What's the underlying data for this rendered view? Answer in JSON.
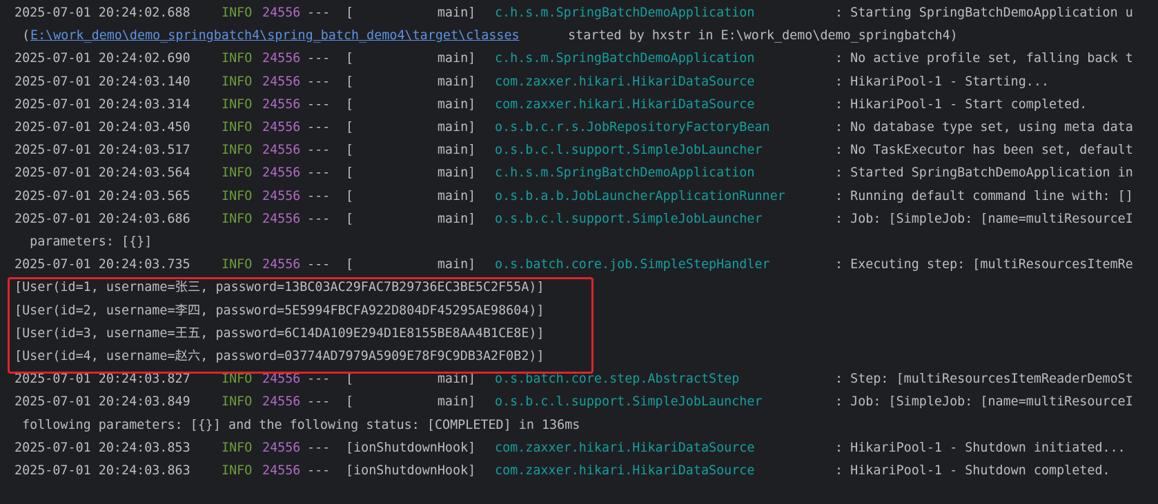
{
  "console": {
    "lines": [
      {
        "kind": "log",
        "ts": "2025-07-01 20:24:02.688",
        "level": "INFO",
        "pid": "24556",
        "sep": "---",
        "thread": "[           main]",
        "logger": "c.h.s.m.SpringBatchDemoApplication",
        "msg": ": Starting SpringBatchDemoApplication u"
      },
      {
        "kind": "cont",
        "pre": " (",
        "link": "E:\\work_demo\\demo_springbatch4\\spring_batch_demo4\\target\\classes",
        "text": " started by hxstr in E:\\work_demo\\demo_springbatch4)"
      },
      {
        "kind": "log",
        "ts": "2025-07-01 20:24:02.690",
        "level": "INFO",
        "pid": "24556",
        "sep": "---",
        "thread": "[           main]",
        "logger": "c.h.s.m.SpringBatchDemoApplication",
        "msg": ": No active profile set, falling back t"
      },
      {
        "kind": "log",
        "ts": "2025-07-01 20:24:03.140",
        "level": "INFO",
        "pid": "24556",
        "sep": "---",
        "thread": "[           main]",
        "logger": "com.zaxxer.hikari.HikariDataSource",
        "msg": ": HikariPool-1 - Starting..."
      },
      {
        "kind": "log",
        "ts": "2025-07-01 20:24:03.314",
        "level": "INFO",
        "pid": "24556",
        "sep": "---",
        "thread": "[           main]",
        "logger": "com.zaxxer.hikari.HikariDataSource",
        "msg": ": HikariPool-1 - Start completed."
      },
      {
        "kind": "log",
        "ts": "2025-07-01 20:24:03.450",
        "level": "INFO",
        "pid": "24556",
        "sep": "---",
        "thread": "[           main]",
        "logger": "o.s.b.c.r.s.JobRepositoryFactoryBean",
        "msg": ": No database type set, using meta data"
      },
      {
        "kind": "log",
        "ts": "2025-07-01 20:24:03.517",
        "level": "INFO",
        "pid": "24556",
        "sep": "---",
        "thread": "[           main]",
        "logger": "o.s.b.c.l.support.SimpleJobLauncher",
        "msg": ": No TaskExecutor has been set, default"
      },
      {
        "kind": "log",
        "ts": "2025-07-01 20:24:03.564",
        "level": "INFO",
        "pid": "24556",
        "sep": "---",
        "thread": "[           main]",
        "logger": "c.h.s.m.SpringBatchDemoApplication",
        "msg": ": Started SpringBatchDemoApplication in"
      },
      {
        "kind": "log",
        "ts": "2025-07-01 20:24:03.565",
        "level": "INFO",
        "pid": "24556",
        "sep": "---",
        "thread": "[           main]",
        "logger": "o.s.b.a.b.JobLauncherApplicationRunner",
        "msg": ": Running default command line with: []"
      },
      {
        "kind": "log",
        "ts": "2025-07-01 20:24:03.686",
        "level": "INFO",
        "pid": "24556",
        "sep": "---",
        "thread": "[           main]",
        "logger": "o.s.b.c.l.support.SimpleJobLauncher",
        "msg": ": Job: [SimpleJob: [name=multiResourceI"
      },
      {
        "kind": "text",
        "text": "  parameters: [{}]",
        "indent": true
      },
      {
        "kind": "log",
        "ts": "2025-07-01 20:24:03.735",
        "level": "INFO",
        "pid": "24556",
        "sep": "---",
        "thread": "[           main]",
        "logger": "o.s.batch.core.job.SimpleStepHandler",
        "msg": ": Executing step: [multiResourcesItemRe"
      },
      {
        "kind": "text",
        "text": "[User(id=1, username=张三, password=13BC03AC29FAC7B29736EC3BE5C2F55A)]"
      },
      {
        "kind": "text",
        "text": "[User(id=2, username=李四, password=5E5994FBCFA922D804DF45295AE98604)]"
      },
      {
        "kind": "text",
        "text": "[User(id=3, username=王五, password=6C14DA109E294D1E8155BE8AA4B1CE8E)]"
      },
      {
        "kind": "text",
        "text": "[User(id=4, username=赵六, password=03774AD7979A5909E78F9C9DB3A2F0B2)]"
      },
      {
        "kind": "log",
        "ts": "2025-07-01 20:24:03.827",
        "level": "INFO",
        "pid": "24556",
        "sep": "---",
        "thread": "[           main]",
        "logger": "o.s.batch.core.step.AbstractStep",
        "msg": ": Step: [multiResourcesItemReaderDemoSt"
      },
      {
        "kind": "log",
        "ts": "2025-07-01 20:24:03.849",
        "level": "INFO",
        "pid": "24556",
        "sep": "---",
        "thread": "[           main]",
        "logger": "o.s.b.c.l.support.SimpleJobLauncher",
        "msg": ": Job: [SimpleJob: [name=multiResourceI"
      },
      {
        "kind": "text",
        "text": " following parameters: [{}] and the following status: [COMPLETED] in 136ms"
      },
      {
        "kind": "log",
        "ts": "2025-07-01 20:24:03.853",
        "level": "INFO",
        "pid": "24556",
        "sep": "---",
        "thread": "[ionShutdownHook]",
        "logger": "com.zaxxer.hikari.HikariDataSource",
        "msg": ": HikariPool-1 - Shutdown initiated..."
      },
      {
        "kind": "log",
        "ts": "2025-07-01 20:24:03.863",
        "level": "INFO",
        "pid": "24556",
        "sep": "---",
        "thread": "[ionShutdownHook]",
        "logger": "com.zaxxer.hikari.HikariDataSource",
        "msg": ": HikariPool-1 - Shutdown completed."
      }
    ]
  },
  "colors": {
    "background": "#1e1f22",
    "text": "#bcbec4",
    "info": "#6a9f3a",
    "pid": "#b26ac9",
    "logger": "#14a0a0",
    "link": "#5c93e6",
    "highlight_border": "#e0242c"
  }
}
